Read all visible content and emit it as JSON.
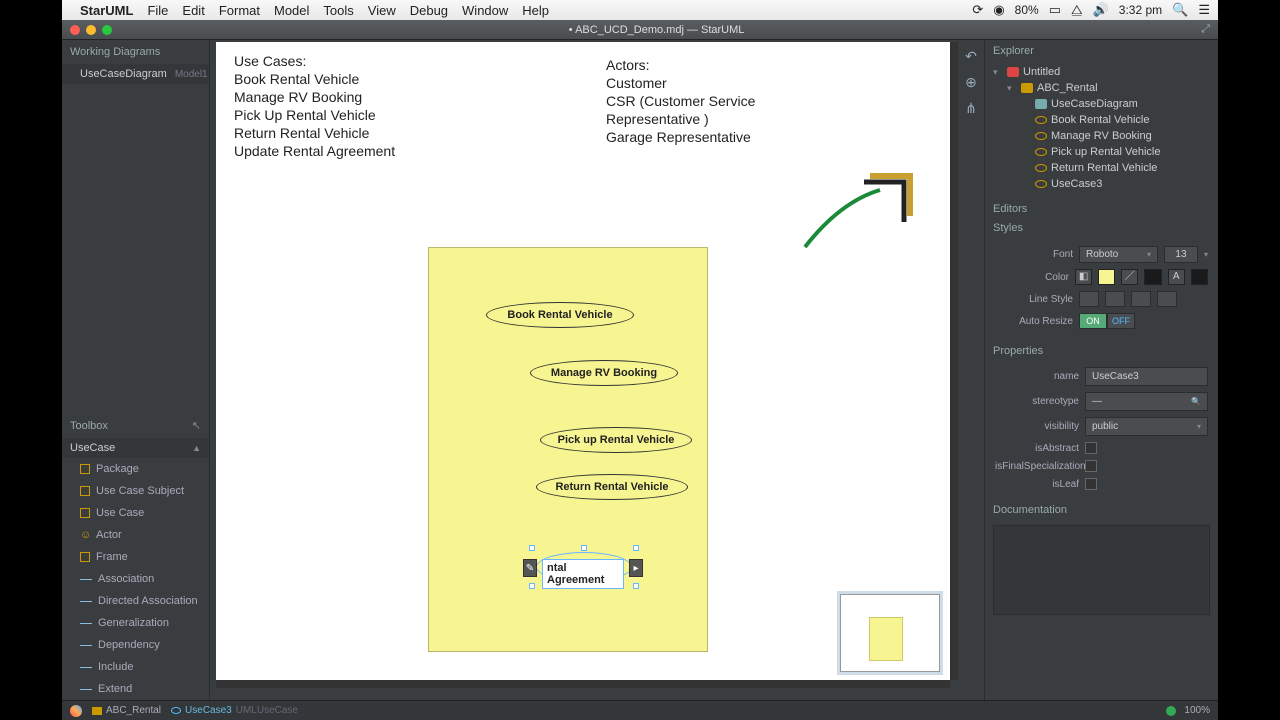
{
  "menubar": {
    "appname": "StarUML",
    "items": [
      "File",
      "Edit",
      "Format",
      "Model",
      "Tools",
      "View",
      "Debug",
      "Window",
      "Help"
    ],
    "battery": "80%",
    "time": "3:32 pm"
  },
  "window": {
    "title": "• ABC_UCD_Demo.mdj — StarUML"
  },
  "workingDiagrams": {
    "title": "Working Diagrams",
    "item": "UseCaseDiagram",
    "itemSub": "Model1"
  },
  "toolbox": {
    "title": "Toolbox",
    "section": "UseCase",
    "items": [
      "Package",
      "Use Case Subject",
      "Use Case",
      "Actor",
      "Frame",
      "Association",
      "Directed Association",
      "Generalization",
      "Dependency",
      "Include",
      "Extend"
    ]
  },
  "canvas": {
    "useCasesHeader": "Use Cases:",
    "useCases": [
      "Book Rental Vehicle",
      "Manage RV Booking",
      "Pick Up Rental Vehicle",
      "Return Rental Vehicle",
      "Update Rental Agreement"
    ],
    "actorsHeader": "Actors:",
    "actors": [
      "Customer",
      "CSR (Customer Service",
      "Representative )",
      "Garage Representative"
    ],
    "ellipses": [
      "Book Rental Vehicle",
      "Manage RV Booking",
      "Pick up Rental Vehicle",
      "Return Rental Vehicle"
    ],
    "editing": "ntal Agreement"
  },
  "explorer": {
    "title": "Explorer",
    "root": "Untitled",
    "pkg": "ABC_Rental",
    "diagram": "UseCaseDiagram",
    "usecases": [
      "Book Rental Vehicle",
      "Manage RV Booking",
      "Pick up Rental Vehicle",
      "Return Rental Vehicle",
      "UseCase3"
    ]
  },
  "editors": {
    "title": "Editors"
  },
  "styles": {
    "title": "Styles",
    "fontLabel": "Font",
    "fontValue": "Roboto",
    "fontSize": "13",
    "colorLabel": "Color",
    "lineStyleLabel": "Line Style",
    "autoResizeLabel": "Auto Resize",
    "on": "ON",
    "off": "OFF"
  },
  "properties": {
    "title": "Properties",
    "name": {
      "label": "name",
      "value": "UseCase3"
    },
    "stereotype": {
      "label": "stereotype",
      "value": "—"
    },
    "visibility": {
      "label": "visibility",
      "value": "public"
    },
    "isAbstract": "isAbstract",
    "isFinalSpecialization": "isFinalSpecialization",
    "isLeaf": "isLeaf"
  },
  "documentation": {
    "title": "Documentation"
  },
  "status": {
    "pkg": "ABC_Rental",
    "uc": "UseCase3",
    "ucType": "UMLUseCase",
    "zoom": "100%"
  }
}
